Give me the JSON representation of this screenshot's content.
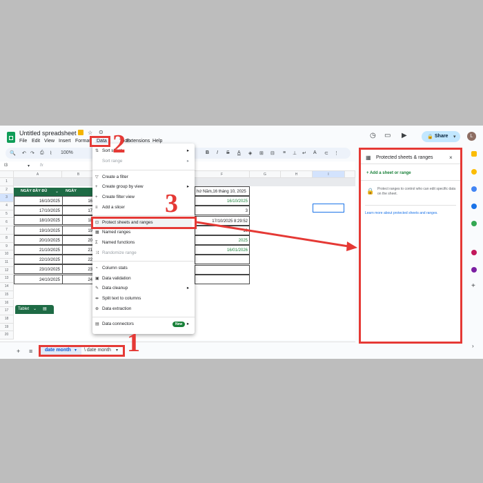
{
  "app": {
    "doc_title": "Untitled spreadsheet",
    "menus": [
      "File",
      "Edit",
      "View",
      "Insert",
      "Format",
      "Data",
      "Tools",
      "Extensions",
      "Help"
    ],
    "share_label": "Share",
    "avatar_letter": "L",
    "zoom": "100%",
    "name_box": "I3",
    "fx": "fx"
  },
  "grid": {
    "columns": [
      "A",
      "B",
      "C",
      "D",
      "E",
      "F",
      "G",
      "H",
      "I"
    ],
    "rows": [
      "1",
      "2",
      "3",
      "4",
      "5",
      "6",
      "7",
      "8",
      "9",
      "10",
      "11",
      "12",
      "13",
      "14",
      "15",
      "16",
      "17",
      "18",
      "19",
      "20"
    ],
    "table_tag": "Tablet",
    "table_headers": [
      "NGÀY ĐẦY ĐỦ",
      "NGÀY"
    ],
    "col_a": [
      "16/10/2025",
      "17/10/2025",
      "18/10/2025",
      "19/10/2025",
      "20/10/2025",
      "21/10/2025",
      "22/10/2025",
      "23/10/2025",
      "24/10/2025"
    ],
    "col_b": [
      "16",
      "17",
      "18",
      "19",
      "20",
      "21",
      "22",
      "23",
      "24"
    ],
    "col_f": [
      "hứ Năm,16 tháng 10, 2025",
      "16/10/2025",
      "3",
      "17/10/2025 8:29:52",
      "10",
      "2025",
      "16/01/2026"
    ]
  },
  "menu": {
    "sort_sheet": "Sort sheet",
    "sort_range": "Sort range",
    "create_filter": "Create a filter",
    "create_group": "Create group by view",
    "create_filter_view": "Create filter view",
    "add_slicer": "Add a slicer",
    "protect": "Protect sheets and ranges",
    "named_ranges": "Named ranges",
    "named_functions": "Named functions",
    "randomize": "Randomize range",
    "column_stats": "Column stats",
    "data_validation": "Data validation",
    "data_cleanup": "Data cleanup",
    "split_text": "Split text to columns",
    "data_extraction": "Data extraction",
    "data_connectors": "Data connectors",
    "new_badge": "New"
  },
  "panel": {
    "title": "Protected sheets & ranges",
    "add_label": "+ Add a sheet or range",
    "info": "Protect ranges to control who can edit specific data on the sheet.",
    "learn_more": "Learn more about protected sheets and ranges."
  },
  "tabs": {
    "tab1": "date month",
    "tab2": "\\ date month"
  },
  "annotations": {
    "n1": "1",
    "n2": "2",
    "n3": "3",
    "color": "#e53935"
  }
}
